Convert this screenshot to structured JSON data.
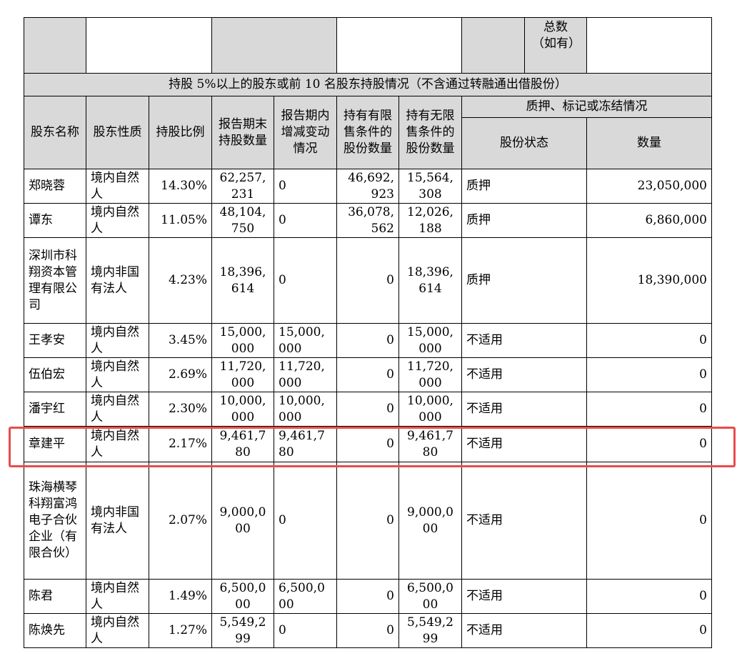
{
  "top_row": {
    "total_label": "总数（如有）"
  },
  "section_title": "持股 5%以上的股东或前 10 名股东持股情况（不含通过转融通出借股份）",
  "headers": {
    "name": "股东名称",
    "nature": "股东性质",
    "ratio": "持股比例",
    "period_end": "报告期末持股数量",
    "change": "报告期内增减变动情况",
    "restricted": "持有有限售条件的股份数量",
    "unrestricted": "持有无限售条件的股份数量",
    "pledge_group": "质押、标记或冻结情况",
    "status": "股份状态",
    "quantity": "数量"
  },
  "rows": [
    {
      "name": "郑晓蓉",
      "nature": "境内自然人",
      "ratio": "14.30%",
      "period_end": "62,257,231",
      "change": "0",
      "restricted": "46,692,923",
      "unrestricted": "15,564,308",
      "status": "质押",
      "quantity": "23,050,000"
    },
    {
      "name": "谭东",
      "nature": "境内自然人",
      "ratio": "11.05%",
      "period_end": "48,104,750",
      "change": "0",
      "restricted": "36,078,562",
      "unrestricted": "12,026,188",
      "status": "质押",
      "quantity": "6,860,000"
    },
    {
      "name": "深圳市科翔资本管理有限公司",
      "nature": "境内非国有法人",
      "ratio": "4.23%",
      "period_end": "18,396,614",
      "change": "0",
      "restricted": "0",
      "unrestricted": "18,396,614",
      "status": "质押",
      "quantity": "18,390,000"
    },
    {
      "name": "王孝安",
      "nature": "境内自然人",
      "ratio": "3.45%",
      "period_end": "15,000,000",
      "change": "15,000,000",
      "restricted": "0",
      "unrestricted": "15,000,000",
      "status": "不适用",
      "quantity": "0"
    },
    {
      "name": "伍伯宏",
      "nature": "境内自然人",
      "ratio": "2.69%",
      "period_end": "11,720,000",
      "change": "11,720,000",
      "restricted": "0",
      "unrestricted": "11,720,000",
      "status": "不适用",
      "quantity": "0"
    },
    {
      "name": "潘宇红",
      "nature": "境内自然人",
      "ratio": "2.30%",
      "period_end": "10,000,000",
      "change": "10,000,000",
      "restricted": "0",
      "unrestricted": "10,000,000",
      "status": "不适用",
      "quantity": "0"
    },
    {
      "name": "章建平",
      "nature": "境内自然人",
      "ratio": "2.17%",
      "period_end": "9,461,780",
      "change": "9,461,780",
      "restricted": "0",
      "unrestricted": "9,461,780",
      "status": "不适用",
      "quantity": "0"
    },
    {
      "name": "珠海横琴科翔富鸿电子合伙企业（有限合伙）",
      "nature": "境内非国有法人",
      "ratio": "2.07%",
      "period_end": "9,000,000",
      "change": "0",
      "restricted": "0",
      "unrestricted": "9,000,000",
      "status": "不适用",
      "quantity": "0"
    },
    {
      "name": "陈君",
      "nature": "境内自然人",
      "ratio": "1.49%",
      "period_end": "6,500,000",
      "change": "6,500,000",
      "restricted": "0",
      "unrestricted": "6,500,000",
      "status": "不适用",
      "quantity": "0"
    },
    {
      "name": "陈焕先",
      "nature": "境内自然人",
      "ratio": "1.27%",
      "period_end": "5,549,299",
      "change": "0",
      "restricted": "0",
      "unrestricted": "5,549,299",
      "status": "不适用",
      "quantity": "0"
    }
  ],
  "colors": {
    "header_gray": "#d9d9d9",
    "highlight_red": "#e84c4c"
  }
}
